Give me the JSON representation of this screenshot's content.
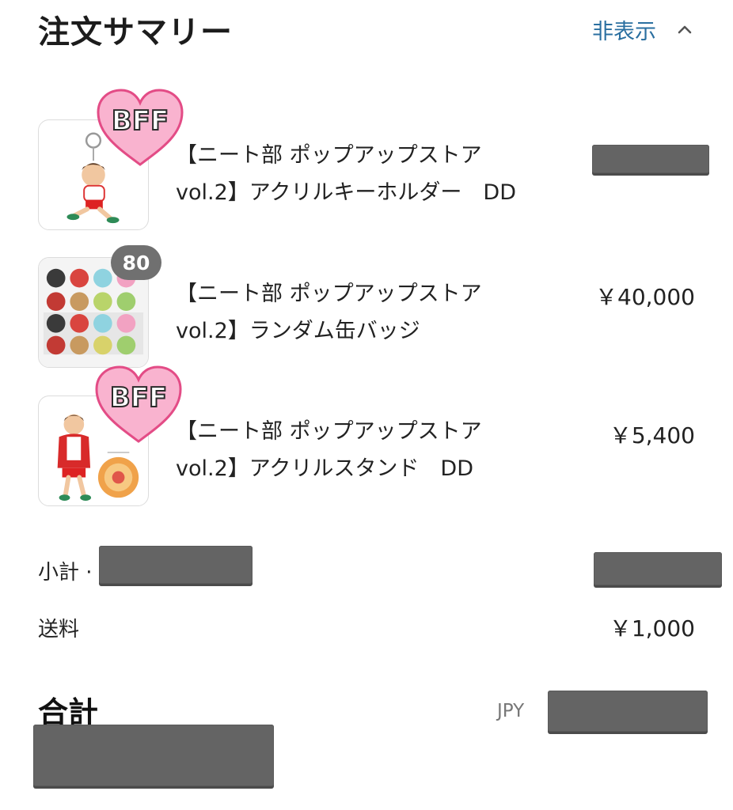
{
  "header": {
    "title": "注文サマリー",
    "toggle_label": "非表示"
  },
  "items": [
    {
      "name_line1": "【ニート部 ポップアップストア",
      "name_line2": "vol.2】アクリルキーホルダー　DD",
      "price": "",
      "badge": "BFF",
      "quantity": ""
    },
    {
      "name_line1": "【ニート部 ポップアップストア",
      "name_line2": "vol.2】ランダム缶バッジ",
      "price": "￥40,000",
      "badge": "",
      "quantity": "80"
    },
    {
      "name_line1": "【ニート部 ポップアップストア",
      "name_line2": "vol.2】アクリルスタンド　DD",
      "price": "￥5,400",
      "badge": "BFF",
      "quantity": ""
    }
  ],
  "summary": {
    "subtotal_label": "小計 ·",
    "shipping_label": "送料",
    "shipping_value": "￥1,000",
    "total_label": "合計",
    "currency": "JPY"
  },
  "colors": {
    "link": "#2a6fa0",
    "badge_pink": "#f7a8c8",
    "badge_outline": "#e0457d",
    "redaction": "#646464"
  }
}
